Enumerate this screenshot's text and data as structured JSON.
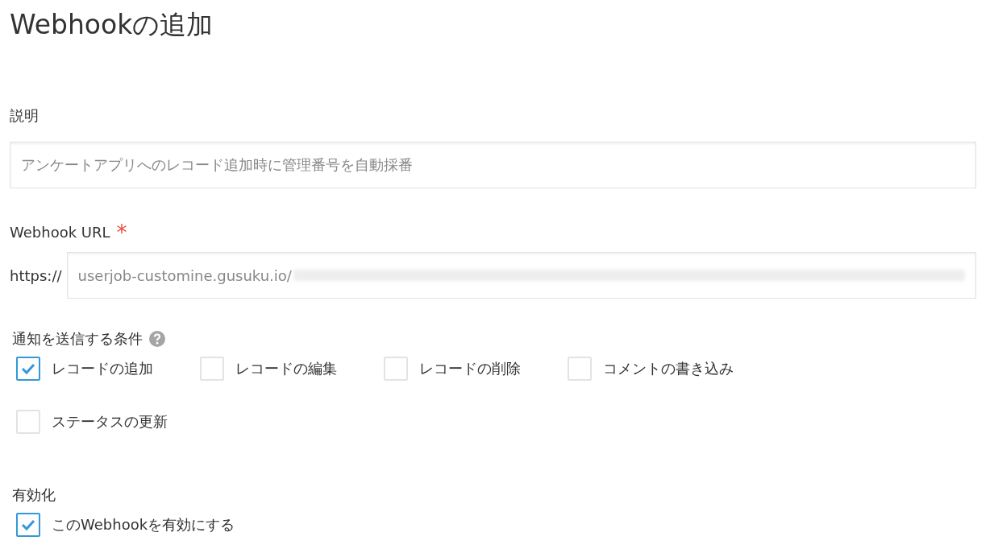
{
  "title": "Webhookの追加",
  "description": {
    "label": "説明",
    "value": "アンケートアプリへのレコード追加時に管理番号を自動採番"
  },
  "url": {
    "label": "Webhook URL",
    "required_mark": "*",
    "prefix": "https://",
    "value": "userjob-customine.gusuku.io/"
  },
  "conditions": {
    "label": "通知を送信する条件",
    "options": [
      {
        "label": "レコードの追加",
        "checked": true
      },
      {
        "label": "レコードの編集",
        "checked": false
      },
      {
        "label": "レコードの削除",
        "checked": false
      },
      {
        "label": "コメントの書き込み",
        "checked": false
      },
      {
        "label": "ステータスの更新",
        "checked": false
      }
    ]
  },
  "enable": {
    "label": "有効化",
    "option": {
      "label": "このWebhookを有効にする",
      "checked": true
    }
  }
}
